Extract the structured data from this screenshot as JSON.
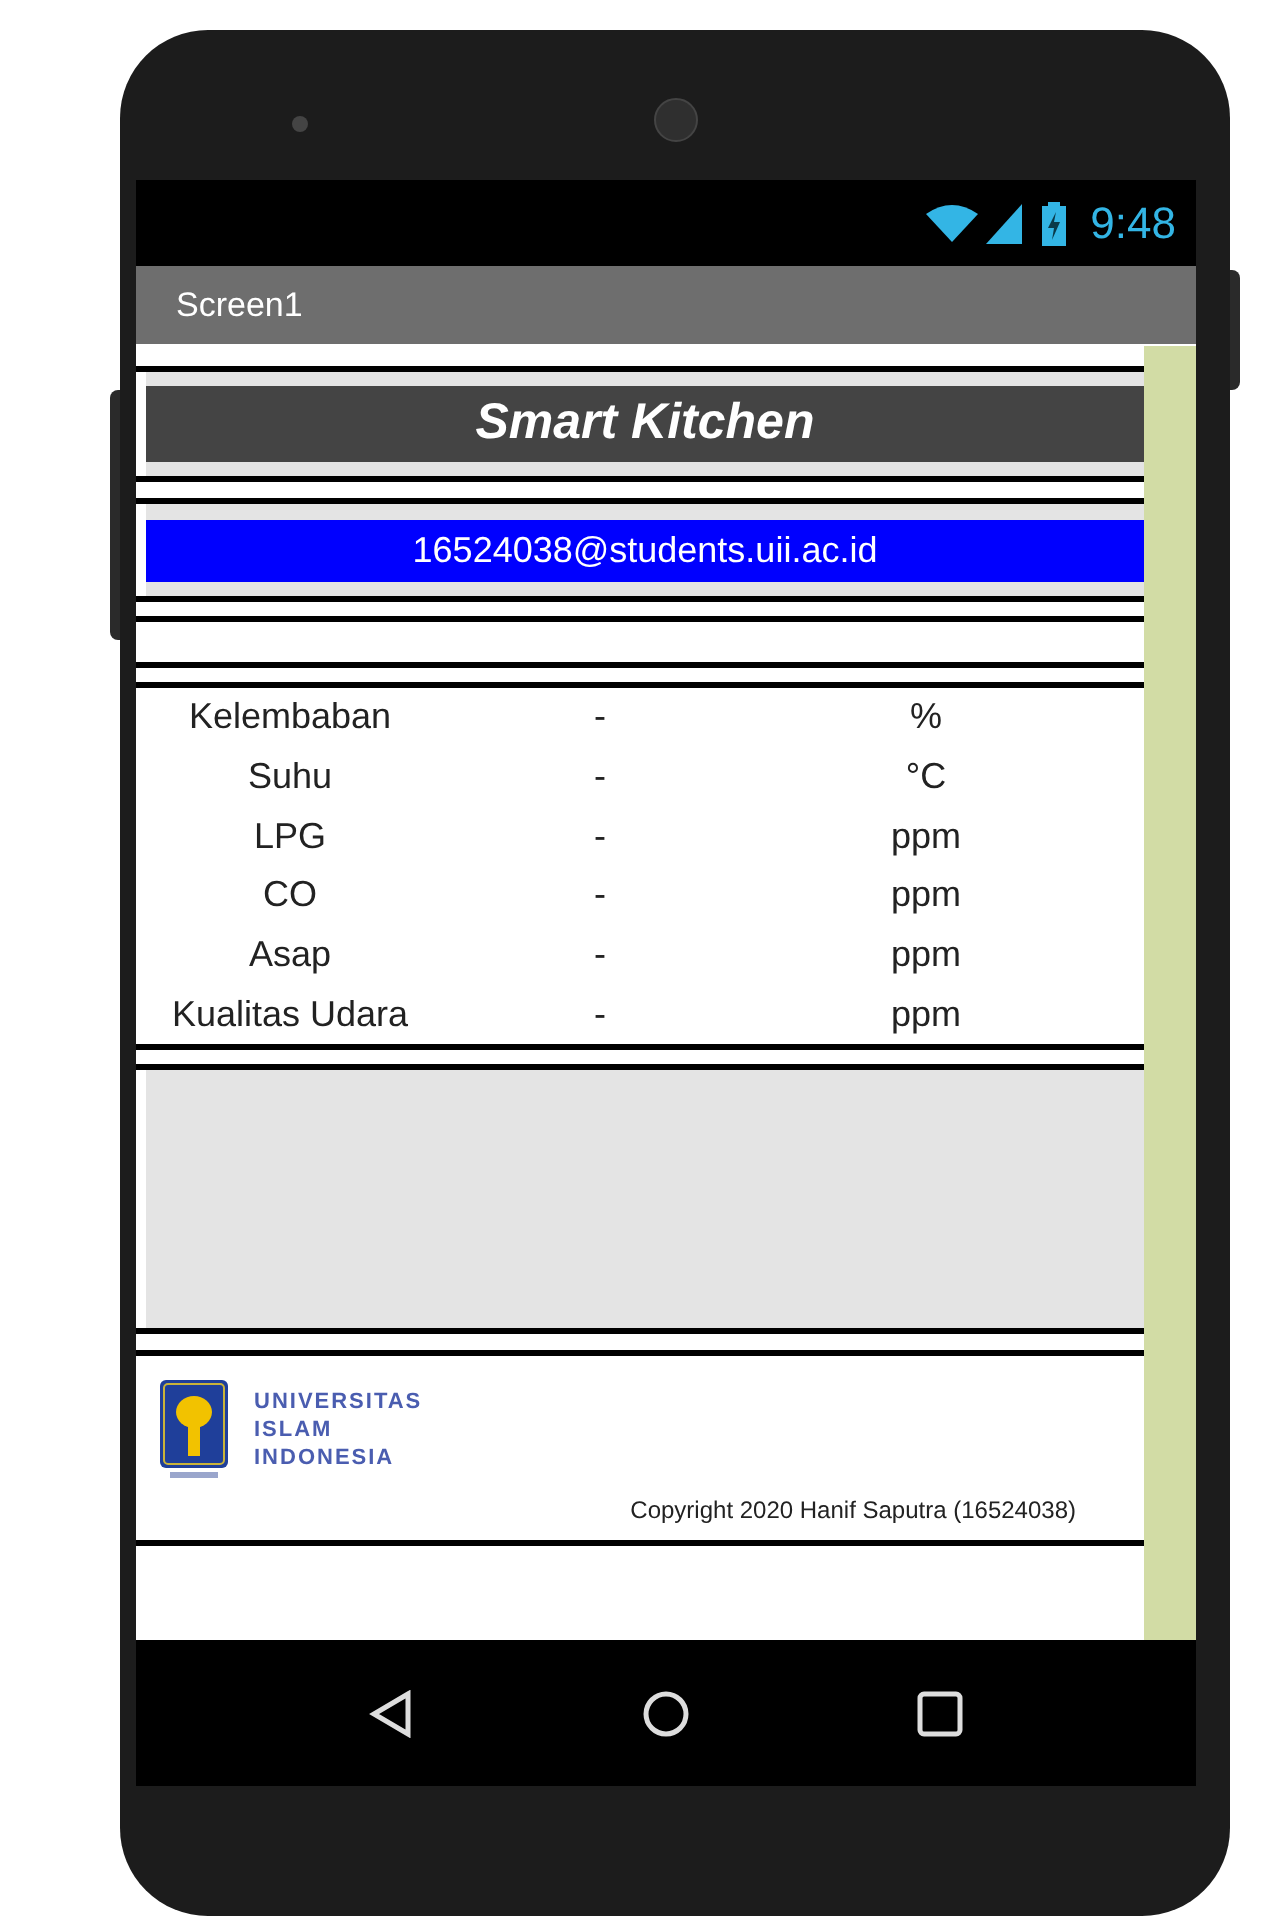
{
  "status_bar": {
    "time": "9:48"
  },
  "title_bar": {
    "title": "Screen1"
  },
  "header": {
    "title": "Smart Kitchen"
  },
  "email": "16524038@students.uii.ac.id",
  "readings": [
    {
      "label": "Kelembaban",
      "value": "-",
      "unit": "%"
    },
    {
      "label": "Suhu",
      "value": "-",
      "unit": "°C"
    },
    {
      "label": "LPG",
      "value": "-",
      "unit": "ppm"
    },
    {
      "label": "CO",
      "value": "-",
      "unit": "ppm"
    },
    {
      "label": "Asap",
      "value": "-",
      "unit": "ppm"
    },
    {
      "label": "Kualitas Udara",
      "value": "-",
      "unit": "ppm"
    }
  ],
  "footer": {
    "logo_text": [
      "UNIVERSITAS",
      "ISLAM",
      "INDONESIA"
    ],
    "copyright": "Copyright 2020 Hanif Saputra (16524038)"
  }
}
